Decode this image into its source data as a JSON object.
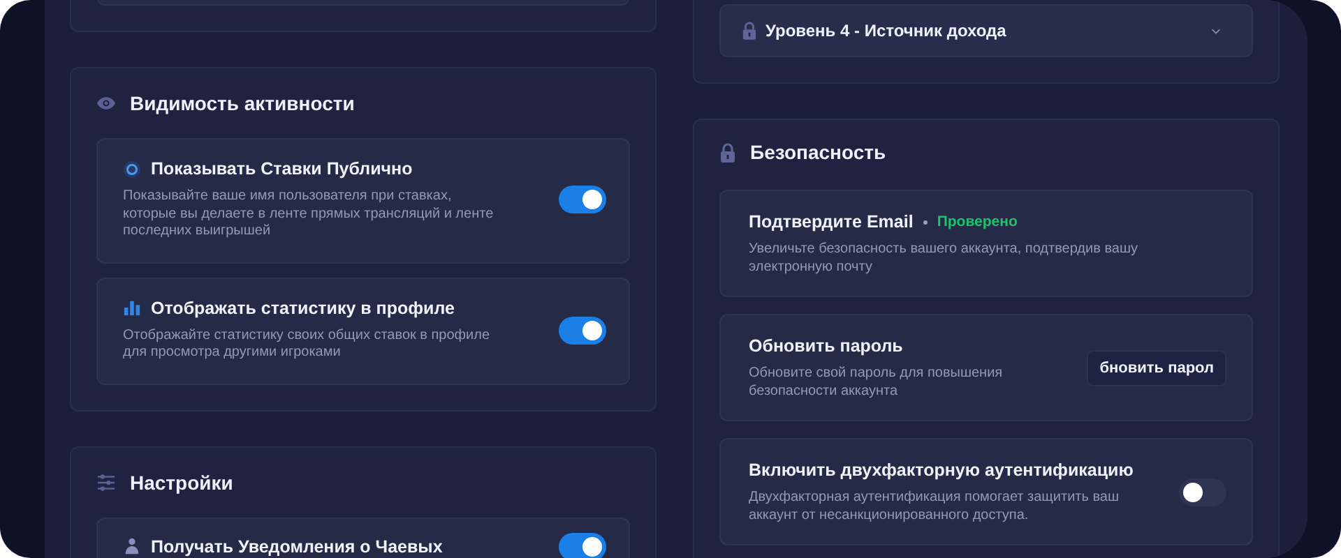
{
  "activity_visibility": {
    "title": "Видимость активности",
    "items": [
      {
        "kind": "dot",
        "title": "Показывать Ставки Публично",
        "description": "Показывайте ваше имя пользователя при ставках, которые вы делаете в ленте прямых трансляций и ленте последних выигрышей",
        "on": true
      },
      {
        "kind": "chart",
        "title": "Отображать статистику в профиле",
        "description": "Отображайте статистику своих общих ставок в профиле для просмотра другими игроками",
        "on": true
      }
    ]
  },
  "settings": {
    "title": "Настройки",
    "items": [
      {
        "kind": "person",
        "title": "Получать Уведомления о Чаевых",
        "on": true
      }
    ]
  },
  "level_dropdown": {
    "label": "Уровень 4 - Источник дохода"
  },
  "security": {
    "title": "Безопасность",
    "items": [
      {
        "kind": "status",
        "title": "Подтвердите Email",
        "status": "Проверено",
        "description": "Увеличьте безопасность вашего аккаунта, подтвердив вашу электронную почту"
      },
      {
        "kind": "button",
        "title": "Обновить пароль",
        "description": "Обновите свой пароль для повышения безопасности аккаунта",
        "button": "бновить парол"
      },
      {
        "kind": "toggle",
        "title": "Включить двухфакторную аутентификацию",
        "description": "Двухфакторная аутентификация помогает защитить ваш аккаунт от несанкционированного доступа.",
        "on": false
      }
    ]
  }
}
